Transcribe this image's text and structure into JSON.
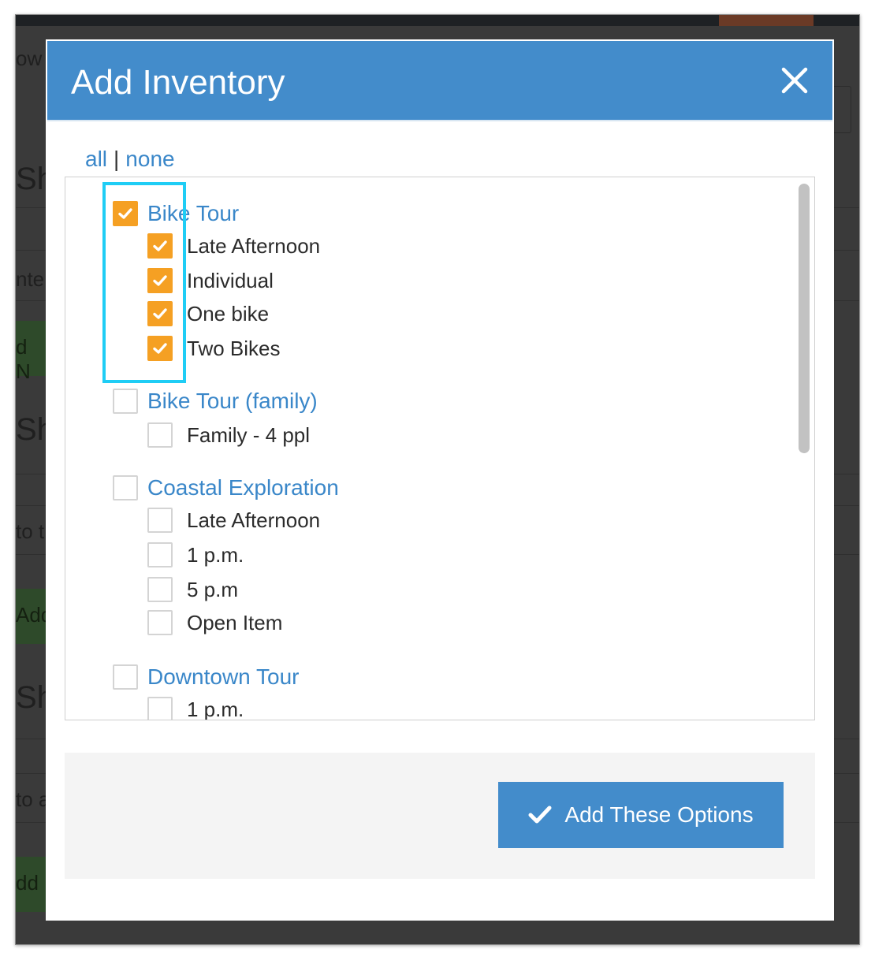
{
  "background": {
    "fragments": [
      "ow",
      "Sh",
      "nte",
      "d N",
      "Sh",
      "to t",
      "Add",
      "Sh",
      "to a",
      "dd"
    ]
  },
  "modal": {
    "title": "Add Inventory",
    "close_icon": "close-icon",
    "select_all": "all",
    "separator": "|",
    "select_none": "none",
    "groups": [
      {
        "label": "Bike Tour",
        "checked": true,
        "items": [
          {
            "label": "Late Afternoon",
            "checked": true
          },
          {
            "label": "Individual",
            "checked": true
          },
          {
            "label": "One bike",
            "checked": true
          },
          {
            "label": "Two Bikes",
            "checked": true
          }
        ]
      },
      {
        "label": "Bike Tour (family)",
        "checked": false,
        "items": [
          {
            "label": "Family - 4 ppl",
            "checked": false
          }
        ]
      },
      {
        "label": "Coastal Exploration",
        "checked": false,
        "items": [
          {
            "label": "Late Afternoon",
            "checked": false
          },
          {
            "label": "1 p.m.",
            "checked": false
          },
          {
            "label": "5 p.m",
            "checked": false
          },
          {
            "label": "Open Item",
            "checked": false
          }
        ]
      },
      {
        "label": "Downtown Tour",
        "checked": false,
        "items": [
          {
            "label": "1 p.m.",
            "checked": false
          }
        ]
      }
    ],
    "submit_label": "Add These Options",
    "submit_icon": "check-icon"
  },
  "colors": {
    "header_bg": "#438ccb",
    "checkbox_checked": "#f5a023",
    "link": "#3a87c9",
    "highlight": "#1fcdf5"
  }
}
